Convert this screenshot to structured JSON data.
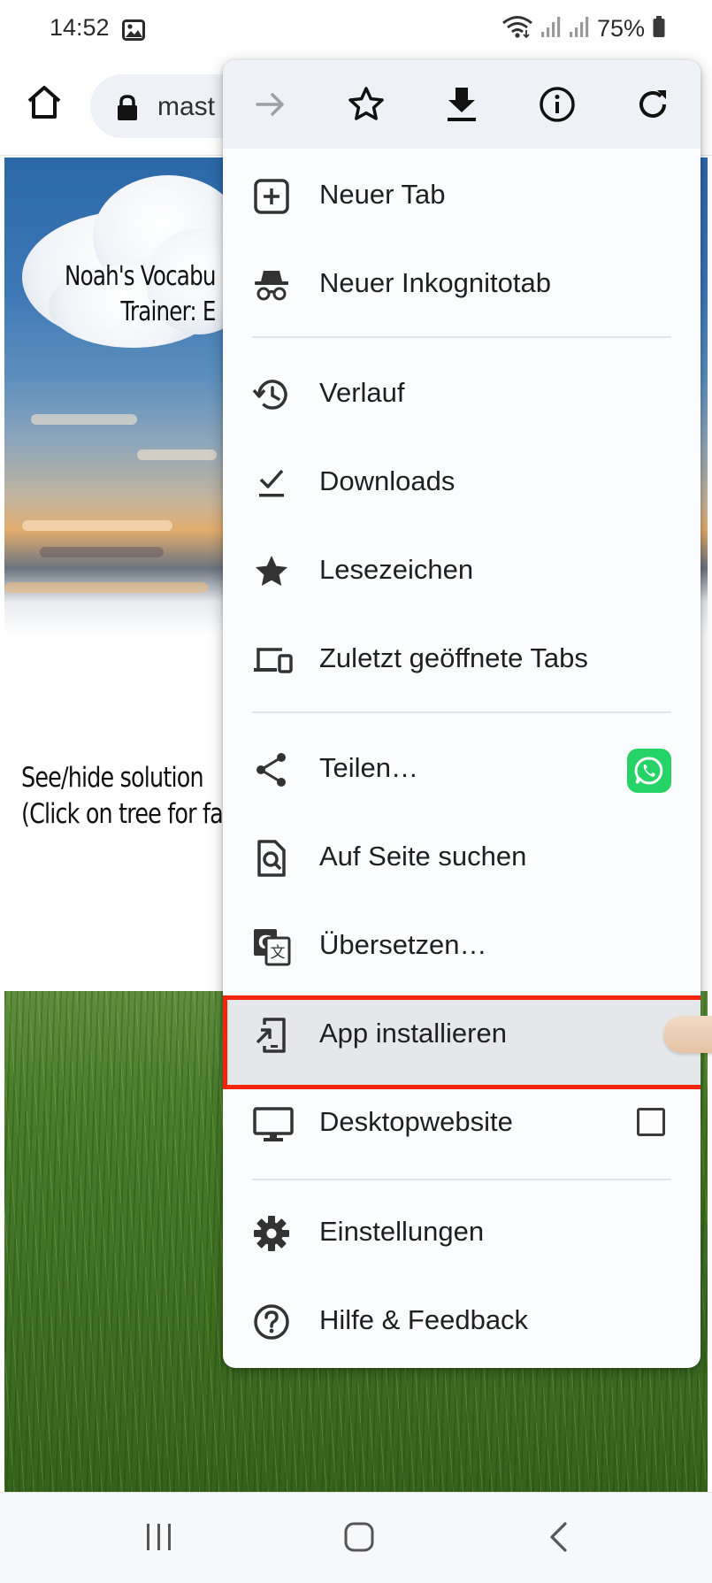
{
  "status_bar": {
    "time": "14:52",
    "battery": "75%",
    "icons": [
      "gallery-icon",
      "wifi-icon",
      "signal-icon",
      "signal-icon",
      "battery-icon"
    ]
  },
  "browser": {
    "url": "mast",
    "icons": [
      "home-icon",
      "lock-icon"
    ]
  },
  "page": {
    "banner_title_line1": "Noah's Vocabu",
    "banner_title_line2": "Trainer: E",
    "solution_line1": "See/hide solution",
    "solution_line2": "(Click on tree for fa"
  },
  "menu": {
    "icon_bar": [
      "forward-arrow-icon",
      "star-outline-icon",
      "download-icon",
      "info-icon",
      "reload-icon"
    ],
    "items": [
      {
        "label": "Neuer Tab",
        "icon": "new-tab-icon"
      },
      {
        "label": "Neuer Inkognitotab",
        "icon": "incognito-icon"
      },
      {
        "label": "Verlauf",
        "icon": "history-icon"
      },
      {
        "label": "Downloads",
        "icon": "downloads-check-icon"
      },
      {
        "label": "Lesezeichen",
        "icon": "star-filled-icon"
      },
      {
        "label": "Zuletzt geöffnete Tabs",
        "icon": "devices-icon"
      },
      {
        "label": "Teilen…",
        "icon": "share-icon",
        "badge": "whatsapp-icon"
      },
      {
        "label": "Auf Seite suchen",
        "icon": "find-in-page-icon"
      },
      {
        "label": "Übersetzen…",
        "icon": "translate-icon"
      },
      {
        "label": "App installieren",
        "icon": "install-app-icon",
        "highlighted": true
      },
      {
        "label": "Desktopwebsite",
        "icon": "desktop-icon",
        "checked": false
      },
      {
        "label": "Einstellungen",
        "icon": "settings-icon"
      },
      {
        "label": "Hilfe & Feedback",
        "icon": "help-icon"
      }
    ]
  },
  "nav_bar": {
    "icons": [
      "recent-apps-icon",
      "home-nav-icon",
      "back-icon"
    ]
  },
  "colors": {
    "highlight_border": "#f3250a",
    "whatsapp_green": "#25d366",
    "menu_background": "#fbfcfd",
    "icon_bar_background": "#eef2f6"
  }
}
